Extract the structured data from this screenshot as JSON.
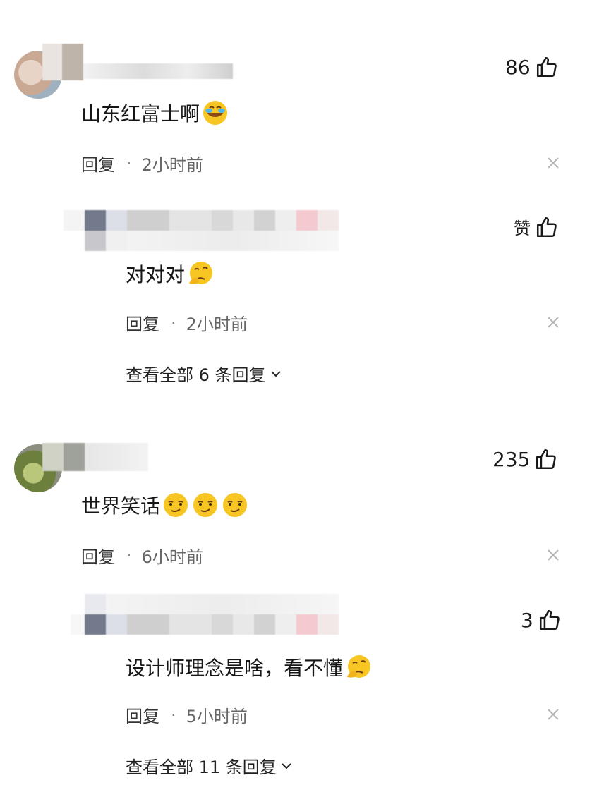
{
  "comments": [
    {
      "text": "山东红富士啊",
      "emoji": [
        "laugh-cry-emoji"
      ],
      "likes": "86",
      "reply_label": "回复",
      "dot": "·",
      "time": "2小时前",
      "sub_reply": {
        "text": "对对对",
        "emoji": [
          "thinking-emoji"
        ],
        "likes": "赞",
        "reply_label": "回复",
        "dot": "·",
        "time": "2小时前"
      },
      "view_all": "查看全部 6 条回复"
    },
    {
      "text": "世界笑话",
      "emoji": [
        "smirk-emoji",
        "smirk-emoji",
        "smirk-emoji"
      ],
      "likes": "235",
      "reply_label": "回复",
      "dot": "·",
      "time": "6小时前",
      "sub_reply": {
        "text": "设计师理念是啥，看不懂",
        "emoji": [
          "thinking-emoji"
        ],
        "likes": "3",
        "reply_label": "回复",
        "dot": "·",
        "time": "5小时前"
      },
      "view_all": "查看全部 11 条回复"
    }
  ],
  "colors": {
    "text": "#161616",
    "meta": "#666666",
    "icon": "#1a1a1a",
    "close": "#b5b5b5"
  }
}
